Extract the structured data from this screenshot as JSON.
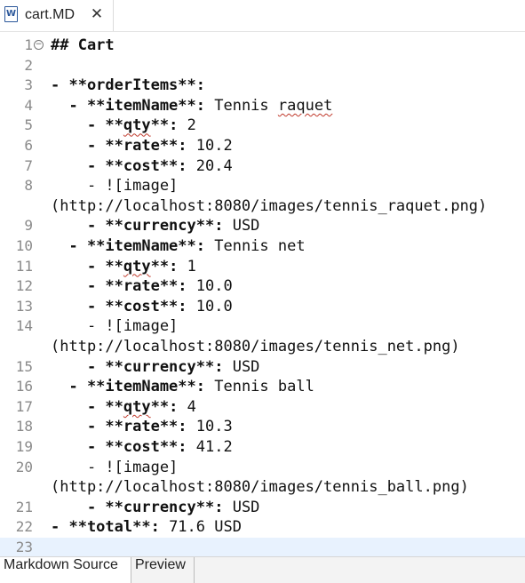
{
  "tab": {
    "title": "cart.MD",
    "icon": "word-document-icon",
    "close_symbol": "✕"
  },
  "editor": {
    "lines": [
      {
        "n": "1",
        "parts": [
          {
            "t": "## Cart",
            "b": true
          }
        ]
      },
      {
        "n": "2",
        "parts": []
      },
      {
        "n": "3",
        "parts": [
          {
            "t": "- **orderItems**:",
            "b": true
          }
        ]
      },
      {
        "n": "4",
        "parts": [
          {
            "t": "  - **itemName**:",
            "b": true
          },
          {
            "t": " Tennis "
          },
          {
            "t": "raquet",
            "sq": true
          }
        ]
      },
      {
        "n": "5",
        "parts": [
          {
            "t": "    - **",
            "b": true
          },
          {
            "t": "qty",
            "b": true,
            "sq": true
          },
          {
            "t": "**:",
            "b": true
          },
          {
            "t": " 2"
          }
        ]
      },
      {
        "n": "6",
        "parts": [
          {
            "t": "    - **rate**:",
            "b": true
          },
          {
            "t": " 10.2"
          }
        ]
      },
      {
        "n": "7",
        "parts": [
          {
            "t": "    - **cost**:",
            "b": true
          },
          {
            "t": " 20.4"
          }
        ]
      },
      {
        "n": "8",
        "parts": [
          {
            "t": "    - ![image]"
          }
        ]
      },
      {
        "n": "",
        "parts": [
          {
            "t": "(http://localhost:8080/images/tennis_raquet.png)"
          }
        ]
      },
      {
        "n": "9",
        "parts": [
          {
            "t": "    - **currency**:",
            "b": true
          },
          {
            "t": " USD"
          }
        ]
      },
      {
        "n": "10",
        "parts": [
          {
            "t": "  - **itemName**:",
            "b": true
          },
          {
            "t": " Tennis net"
          }
        ]
      },
      {
        "n": "11",
        "parts": [
          {
            "t": "    - **",
            "b": true
          },
          {
            "t": "qty",
            "b": true,
            "sq": true
          },
          {
            "t": "**:",
            "b": true
          },
          {
            "t": " 1"
          }
        ]
      },
      {
        "n": "12",
        "parts": [
          {
            "t": "    - **rate**:",
            "b": true
          },
          {
            "t": " 10.0"
          }
        ]
      },
      {
        "n": "13",
        "parts": [
          {
            "t": "    - **cost**:",
            "b": true
          },
          {
            "t": " 10.0"
          }
        ]
      },
      {
        "n": "14",
        "parts": [
          {
            "t": "    - ![image]"
          }
        ]
      },
      {
        "n": "",
        "parts": [
          {
            "t": "(http://localhost:8080/images/tennis_net.png)"
          }
        ]
      },
      {
        "n": "15",
        "parts": [
          {
            "t": "    - **currency**:",
            "b": true
          },
          {
            "t": " USD"
          }
        ]
      },
      {
        "n": "16",
        "parts": [
          {
            "t": "  - **itemName**:",
            "b": true
          },
          {
            "t": " Tennis ball"
          }
        ]
      },
      {
        "n": "17",
        "parts": [
          {
            "t": "    - **",
            "b": true
          },
          {
            "t": "qty",
            "b": true,
            "sq": true
          },
          {
            "t": "**:",
            "b": true
          },
          {
            "t": " 4"
          }
        ]
      },
      {
        "n": "18",
        "parts": [
          {
            "t": "    - **rate**:",
            "b": true
          },
          {
            "t": " 10.3"
          }
        ]
      },
      {
        "n": "19",
        "parts": [
          {
            "t": "    - **cost**:",
            "b": true
          },
          {
            "t": " 41.2"
          }
        ]
      },
      {
        "n": "20",
        "parts": [
          {
            "t": "    - ![image]"
          }
        ]
      },
      {
        "n": "",
        "parts": [
          {
            "t": "(http://localhost:8080/images/tennis_ball.png)"
          }
        ]
      },
      {
        "n": "21",
        "parts": [
          {
            "t": "    - **currency**:",
            "b": true
          },
          {
            "t": " USD"
          }
        ]
      },
      {
        "n": "22",
        "parts": [
          {
            "t": "- **total**:",
            "b": true
          },
          {
            "t": " 71.6 USD"
          }
        ]
      },
      {
        "n": "23",
        "parts": [],
        "current": true
      }
    ]
  },
  "bottom_tabs": [
    {
      "label": "Markdown Source",
      "active": true
    },
    {
      "label": "Preview",
      "active": false
    }
  ]
}
